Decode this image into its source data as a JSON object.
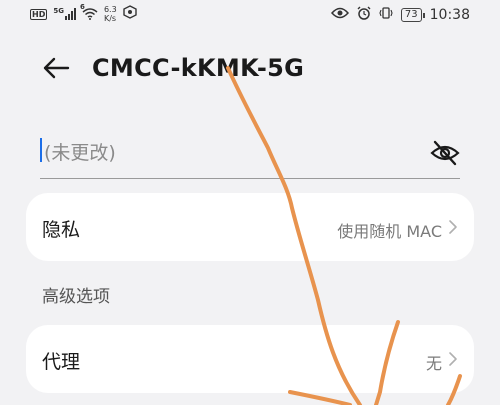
{
  "status_bar": {
    "hd_label": "HD",
    "signal_label": "5G",
    "wifi_label": "6",
    "net_speed_value": "6.3",
    "net_speed_unit": "K/s",
    "battery": "73",
    "time": "10:38",
    "icons": [
      "hd-icon",
      "signal-icon",
      "wifi-icon",
      "app-icon",
      "eye-icon",
      "alarm-icon",
      "vibrate-icon",
      "battery-icon"
    ]
  },
  "header": {
    "title": "CMCC-kKMK-5G"
  },
  "password": {
    "placeholder": "(未更改)"
  },
  "privacy": {
    "label": "隐私",
    "value": "使用随机 MAC"
  },
  "advanced": {
    "section_title": "高级选项"
  },
  "proxy": {
    "label": "代理",
    "value": "无"
  },
  "colors": {
    "caret": "#1c6ee8",
    "scribble": "#e8934e",
    "background": "#f2f2f4"
  }
}
